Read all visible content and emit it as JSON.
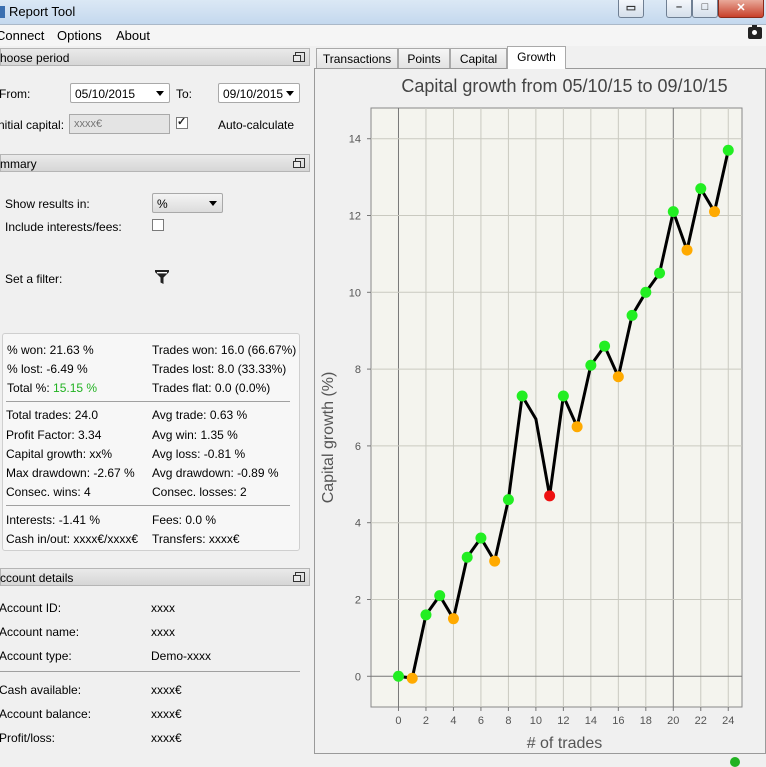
{
  "window": {
    "title": "Report Tool"
  },
  "menu": {
    "items": [
      "Connect",
      "Options",
      "About"
    ]
  },
  "period": {
    "header": "hoose period",
    "from_label": "From:",
    "from_value": "05/10/2015",
    "to_label": "To:",
    "to_value": "09/10/2015",
    "capital_label": "nitial capital:",
    "capital_placeholder": "xxxx€",
    "auto_calc_label": "Auto-calculate",
    "auto_calc_checked": true
  },
  "summary": {
    "header": "mmary",
    "show_results_label": "Show results in:",
    "show_results_value": "%",
    "include_fees_label": "Include interests/fees:",
    "include_fees_checked": false,
    "filter_label": "Set a filter:",
    "stats": {
      "won_pct": "% won: 21.63 %",
      "lost_pct": "% lost: -6.49 %",
      "total_label": "Total %:",
      "total_value": "15.15 %",
      "trades_won": "Trades won: 16.0 (66.67%)",
      "trades_lost": "Trades lost: 8.0 (33.33%)",
      "trades_flat": "Trades flat: 0.0 (0.0%)",
      "total_trades": "Total trades: 24.0",
      "profit_factor": "Profit Factor: 3.34",
      "capital_growth": "Capital growth: xx%",
      "max_drawdown": "Max drawdown: -2.67 %",
      "consec_wins": "Consec. wins: 4",
      "avg_trade": "Avg trade: 0.63 %",
      "avg_win": "Avg win: 1.35 %",
      "avg_loss": "Avg loss: -0.81 %",
      "avg_drawdown": "Avg drawdown: -0.89 %",
      "consec_losses": "Consec. losses: 2",
      "interests": "Interests: -1.41 %",
      "cash_inout": "Cash in/out: xxxx€/xxxx€",
      "fees": "Fees: 0.0 %",
      "transfers": "Transfers: xxxx€"
    }
  },
  "account": {
    "header": "ccount details",
    "id_label": "Account ID:",
    "id_value": "xxxx",
    "name_label": "Account name:",
    "name_value": "xxxx",
    "type_label": "Account type:",
    "type_value": "Demo-xxxx",
    "cash_label": "Cash available:",
    "cash_value": "xxxx€",
    "balance_label": "Account balance:",
    "balance_value": "xxxx€",
    "pl_label": "Profit/loss:",
    "pl_value": "xxxx€"
  },
  "tabs": [
    "Transactions",
    "Points",
    "Capital",
    "Growth"
  ],
  "active_tab": "Growth",
  "colors": {
    "win": "#22ee22",
    "loss": "#ffaa00",
    "worst": "#ee1111",
    "line": "#000000",
    "accent_green": "#22b222"
  },
  "chart_data": {
    "type": "line",
    "title": "Capital growth from 05/10/15 to 09/10/15",
    "xlabel": "# of trades",
    "ylabel": "Capital growth (%)",
    "xlim": [
      -2,
      25
    ],
    "ylim": [
      -0.8,
      14.8
    ],
    "xticks": [
      0,
      2,
      4,
      6,
      8,
      10,
      12,
      14,
      16,
      18,
      20,
      22,
      24
    ],
    "yticks": [
      0,
      2,
      4,
      6,
      8,
      10,
      12,
      14
    ],
    "grid": true,
    "x": [
      0,
      1,
      2,
      3,
      4,
      5,
      6,
      7,
      8,
      9,
      10,
      11,
      12,
      13,
      14,
      15,
      16,
      17,
      18,
      19,
      20,
      21,
      22,
      23,
      24
    ],
    "values": [
      0,
      -0.05,
      1.6,
      2.1,
      1.5,
      3.1,
      3.6,
      3.0,
      4.6,
      7.3,
      6.7,
      4.7,
      7.3,
      6.5,
      8.1,
      8.6,
      7.8,
      9.4,
      10.0,
      10.5,
      12.1,
      11.1,
      12.7,
      12.1,
      13.7
    ],
    "point_types": [
      "win",
      "loss",
      "win",
      "win",
      "loss",
      "win",
      "win",
      "loss",
      "win",
      "win",
      "none",
      "worst",
      "win",
      "loss",
      "win",
      "win",
      "loss",
      "win",
      "win",
      "win",
      "win",
      "loss",
      "win",
      "loss",
      "win"
    ]
  }
}
